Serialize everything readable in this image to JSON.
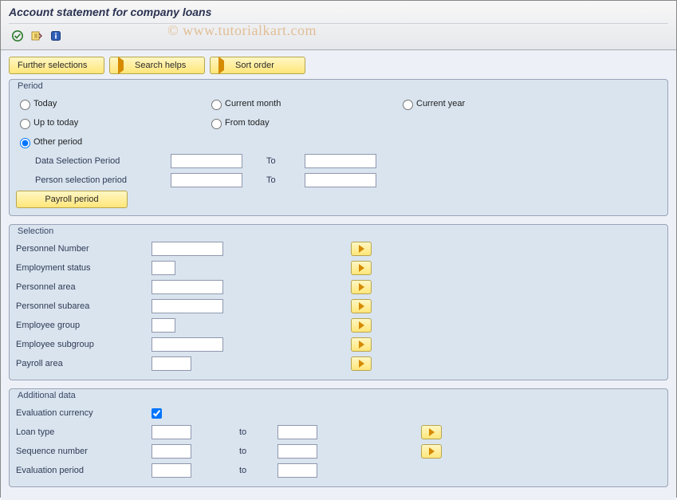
{
  "header": {
    "title": "Account statement for company loans",
    "watermark": "© www.tutorialkart.com"
  },
  "toolbar": {
    "icon_execute": "execute",
    "icon_getvar": "get-variant",
    "icon_info": "information"
  },
  "buttons": {
    "further_selections": "Further selections",
    "search_helps": "Search helps",
    "sort_order": "Sort order",
    "payroll_period": "Payroll period"
  },
  "period": {
    "group_label": "Period",
    "today": "Today",
    "current_month": "Current month",
    "current_year": "Current year",
    "up_to_today": "Up to today",
    "from_today": "From today",
    "other_period": "Other period",
    "data_sel_lbl": "Data Selection Period",
    "person_sel_lbl": "Person selection period",
    "to": "To"
  },
  "selection": {
    "group_label": "Selection",
    "rows": [
      "Personnel Number",
      "Employment status",
      "Personnel area",
      "Personnel subarea",
      "Employee group",
      "Employee subgroup",
      "Payroll area"
    ]
  },
  "additional": {
    "group_label": "Additional data",
    "eval_curr": "Evaluation currency",
    "loan_type": "Loan type",
    "seq_num": "Sequence number",
    "eval_period": "Evaluation period",
    "to": "to"
  }
}
